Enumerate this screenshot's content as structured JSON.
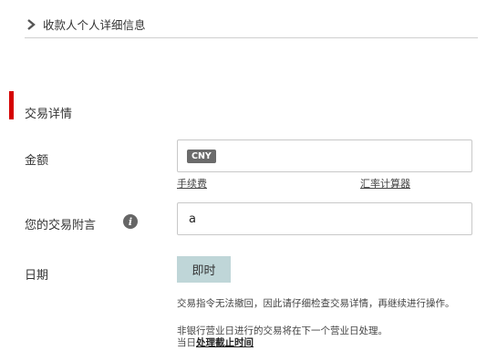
{
  "collapsible": {
    "label": "收款人个人详细信息"
  },
  "section": {
    "title": "交易详情"
  },
  "fields": {
    "amount": {
      "label": "金额",
      "currency": "CNY",
      "value": ""
    },
    "message": {
      "label": "您的交易附言",
      "value": "a"
    },
    "date": {
      "label": "日期",
      "button_label": "即时"
    }
  },
  "links": {
    "fees": "手续费",
    "calculator": "汇率计算器"
  },
  "notes": {
    "line1": "交易指令无法撤回，因此请仔细检查交易详情，再继续进行操作。",
    "line2": "非银行营业日进行的交易将在下一个营业日处理。",
    "line3_prefix": "当日",
    "line3_link": "处理截止时间"
  },
  "colors": {
    "accent": "#d50000",
    "date_button": "#bfd6d8",
    "badge": "#6b6b6b"
  }
}
